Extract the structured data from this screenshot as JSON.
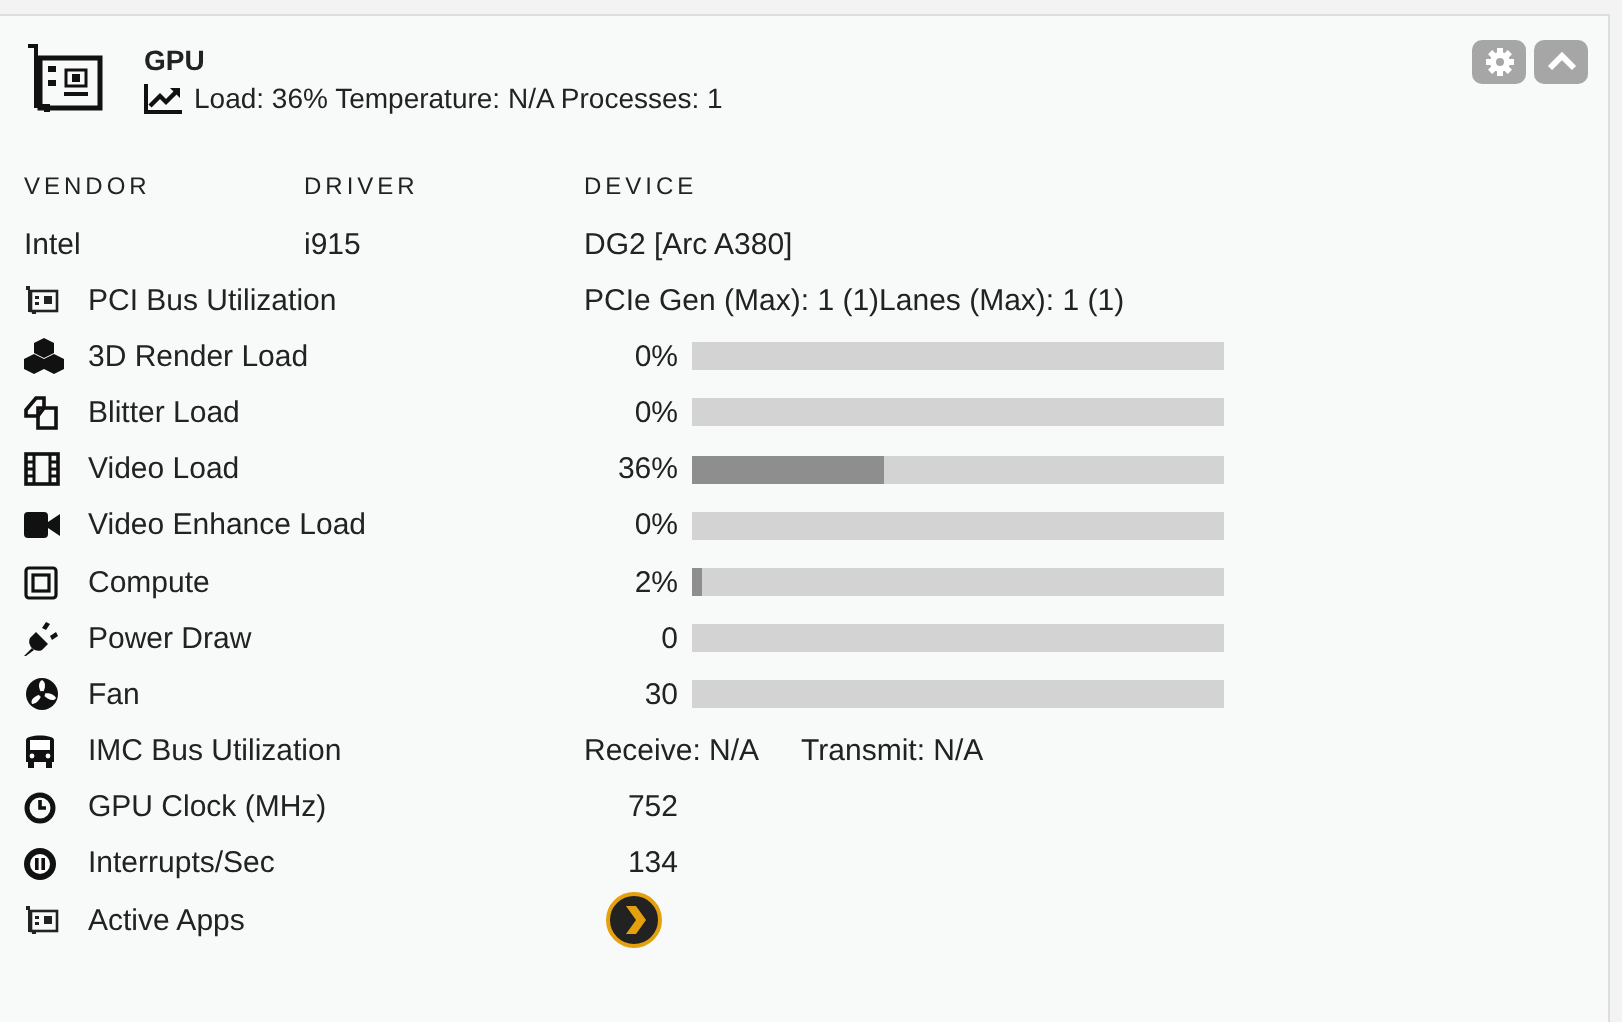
{
  "card": {
    "title": "GPU",
    "summary": "Load: 36% Temperature: N/A Processes: 1"
  },
  "info": {
    "columns": [
      "VENDOR",
      "DRIVER",
      "DEVICE"
    ],
    "values": [
      "Intel",
      "i915",
      "DG2 [Arc A380]"
    ]
  },
  "rows": [
    {
      "kind": "text",
      "label": "PCI Bus Utilization",
      "values": [
        "PCIe Gen (Max): 1 (1)Lanes (Max): 1 (1)"
      ]
    },
    {
      "kind": "bar",
      "label": "3D Render Load",
      "reading": "0%",
      "level": 0
    },
    {
      "kind": "bar",
      "label": "Blitter Load",
      "reading": "0%",
      "level": 0
    },
    {
      "kind": "bar",
      "label": "Video Load",
      "reading": "36%",
      "level": 0.36
    },
    {
      "kind": "bar",
      "label": "Video Enhance Load",
      "reading": "0%",
      "level": 0
    },
    {
      "kind": "bar",
      "label": "Compute",
      "reading": "2%",
      "level": 0.02
    },
    {
      "kind": "bar",
      "label": "Power Draw",
      "reading": "0",
      "level": 0
    },
    {
      "kind": "bar",
      "label": "Fan",
      "reading": "30",
      "level": 0
    },
    {
      "kind": "text",
      "label": "IMC Bus Utilization",
      "values": [
        "Receive: N/A",
        "Transmit: N/A"
      ]
    },
    {
      "kind": "number",
      "label": "GPU Clock (MHz)",
      "reading": "752"
    },
    {
      "kind": "number",
      "label": "Interrupts/Sec",
      "reading": "134"
    },
    {
      "kind": "apps",
      "label": "Active Apps"
    }
  ]
}
